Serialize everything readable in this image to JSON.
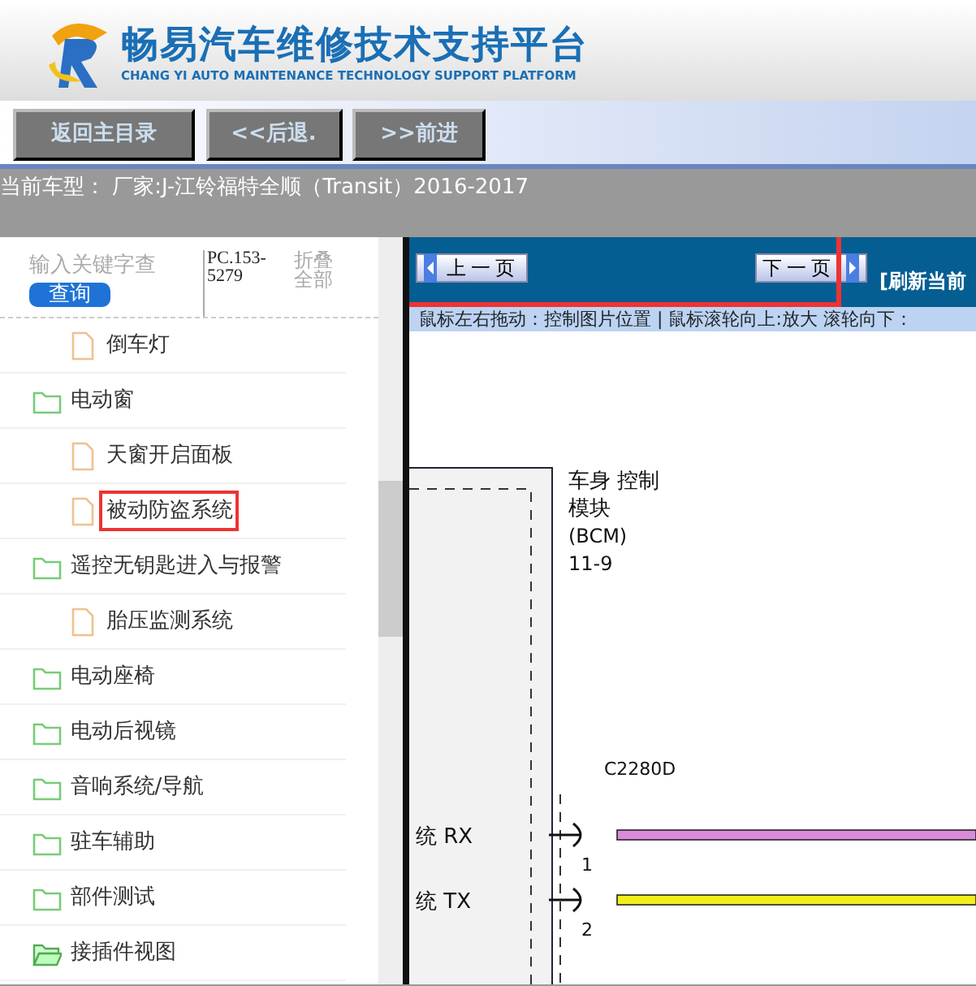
{
  "header": {
    "title": "畅易汽车维修技术支持平台",
    "subtitle": "CHANG YI AUTO MAINTENANCE TECHNOLOGY SUPPORT PLATFORM"
  },
  "toolbar": {
    "buttons": [
      "返回主目录",
      "<<后退.",
      ">>前进"
    ]
  },
  "vehicle_line": "当前车型： 厂家:J-江铃福特全顺（Transit）2016-2017",
  "sidebar": {
    "search": {
      "placeholder": "输入关键字查",
      "button": "查询",
      "code": "PC.153-5279",
      "collapse_all": "折叠全部"
    },
    "tree": [
      {
        "kind": "continuation",
        "children": [
          {
            "kind": "file",
            "label": "倒车灯",
            "highlighted": false
          }
        ]
      },
      {
        "kind": "folder",
        "label": "电动窗",
        "children": [
          {
            "kind": "file",
            "label": "天窗开启面板",
            "highlighted": false
          },
          {
            "kind": "file",
            "label": "被动防盗系统",
            "highlighted": true
          }
        ]
      },
      {
        "kind": "folder",
        "label": "遥控无钥匙进入与报警",
        "children": [
          {
            "kind": "file",
            "label": "胎压监测系统",
            "highlighted": false
          }
        ]
      },
      {
        "kind": "folder",
        "label": "电动座椅"
      },
      {
        "kind": "folder",
        "label": "电动后视镜"
      },
      {
        "kind": "folder",
        "label": "音响系统/导航"
      },
      {
        "kind": "folder",
        "label": "驻车辅助"
      },
      {
        "kind": "folder",
        "label": "部件测试"
      },
      {
        "kind": "folder_open",
        "label": "接插件视图"
      }
    ]
  },
  "viewer": {
    "prev_page": "上一页",
    "next_page": "下一页",
    "nav_highlighted": true,
    "refresh": "[刷新当前",
    "hint": "鼠标左右拖动：控制图片位置 | 鼠标滚轮向上:放大  滚轮向下：",
    "diagram": {
      "module_label": [
        "车身 控制",
        "模块",
        "(BCM)",
        "11-9"
      ],
      "connector": "C2280D",
      "wires": [
        {
          "signal": "统 RX",
          "pin": "1",
          "color": "#d98bd9"
        },
        {
          "signal": "统 TX",
          "pin": "2",
          "color": "#f2ee1a"
        }
      ]
    }
  }
}
